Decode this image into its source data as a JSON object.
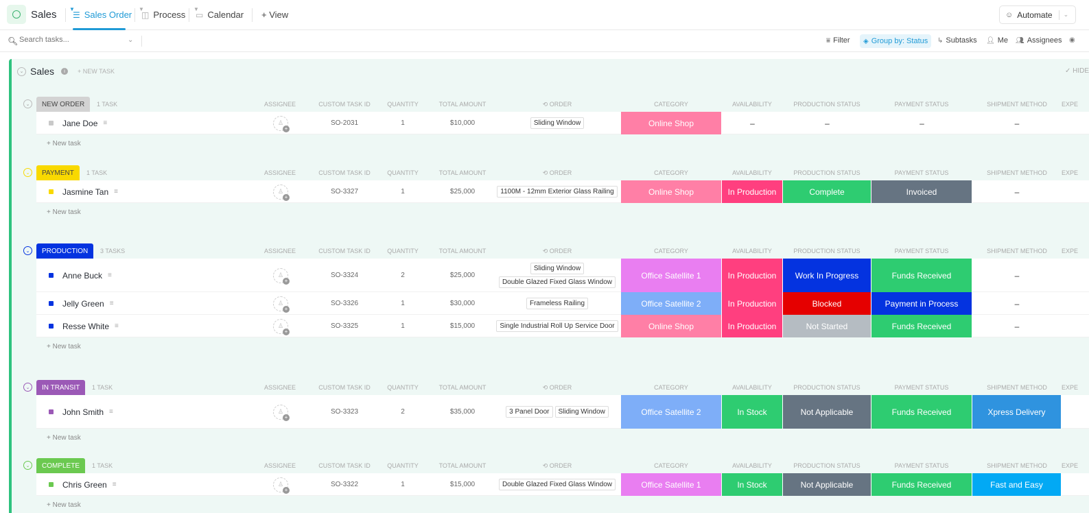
{
  "header": {
    "app_title": "Sales",
    "tabs": [
      {
        "label": "Sales Order",
        "icon": "list-icon",
        "active": true
      },
      {
        "label": "Process",
        "icon": "board-icon",
        "active": false
      },
      {
        "label": "Calendar",
        "icon": "calendar-icon",
        "active": false
      }
    ],
    "add_view_label": "+ View",
    "automate_label": "Automate"
  },
  "toolbar": {
    "search_placeholder": "Search tasks...",
    "filter_label": "Filter",
    "group_by_label": "Group by: Status",
    "subtasks_label": "Subtasks",
    "me_label": "Me",
    "assignees_label": "Assignees"
  },
  "list": {
    "title": "Sales",
    "new_task_label": "+ NEW TASK",
    "hide_label": "✓ HIDE"
  },
  "columns": [
    "ASSIGNEE",
    "CUSTOM TASK ID",
    "QUANTITY",
    "TOTAL AMOUNT",
    "ORDER",
    "CATEGORY",
    "AVAILABILITY",
    "PRODUCTION STATUS",
    "PAYMENT STATUS",
    "SHIPMENT METHOD",
    "EXPE"
  ],
  "new_task_row_label": "+ New task",
  "colors": {
    "accent": "#1f9ad6",
    "list_bar": "#2ec27e",
    "online_shop": "#ff7fa6",
    "office_satellite_1": "#e97ef1",
    "office_satellite_2": "#7eaef8",
    "in_production": "#ff3f7f",
    "in_stock": "#2ecc71",
    "complete": "#2ecc71",
    "invoiced": "#667482",
    "work_in_progress": "#0433e0",
    "blocked": "#e50000",
    "not_started": "#b5bcc2",
    "not_applicable": "#667482",
    "funds_received": "#2ecc71",
    "payment_in_process": "#0433e0",
    "xpress_delivery": "#2f93df",
    "fast_and_easy": "#02a9f4"
  },
  "groups": [
    {
      "status": "NEW ORDER",
      "count": "1 TASK",
      "badge_bg": "#d3d3d3",
      "badge_fg": "#444444",
      "tasks": [
        {
          "name": "Jane Doe",
          "id": "SO-2031",
          "quantity": "1",
          "amount": "$10,000",
          "order": [
            "Sliding Window"
          ],
          "category": "Online Shop",
          "category_color": "#ff7fa6",
          "availability": "–",
          "availability_color": null,
          "production": "–",
          "production_color": null,
          "payment": "–",
          "payment_color": null,
          "shipment": "–",
          "shipment_color": null
        }
      ]
    },
    {
      "status": "PAYMENT",
      "count": "1 TASK",
      "badge_bg": "#f9d900",
      "badge_fg": "#444444",
      "tasks": [
        {
          "name": "Jasmine Tan",
          "id": "SO-3327",
          "quantity": "1",
          "amount": "$25,000",
          "order": [
            "1100M - 12mm Exterior Glass Railing"
          ],
          "category": "Online Shop",
          "category_color": "#ff7fa6",
          "availability": "In Production",
          "availability_color": "#ff3f7f",
          "production": "Complete",
          "production_color": "#2ecc71",
          "payment": "Invoiced",
          "payment_color": "#667482",
          "shipment": "–",
          "shipment_color": null
        }
      ]
    },
    {
      "status": "PRODUCTION",
      "count": "3 TASKS",
      "badge_bg": "#0433e0",
      "badge_fg": "#ffffff",
      "tasks": [
        {
          "name": "Anne Buck",
          "id": "SO-3324",
          "quantity": "2",
          "amount": "$25,000",
          "order": [
            "Sliding Window",
            "Double Glazed Fixed Glass Window"
          ],
          "category": "Office Satellite 1",
          "category_color": "#e97ef1",
          "availability": "In Production",
          "availability_color": "#ff3f7f",
          "production": "Work In Progress",
          "production_color": "#0433e0",
          "payment": "Funds Received",
          "payment_color": "#2ecc71",
          "shipment": "–",
          "shipment_color": null
        },
        {
          "name": "Jelly Green",
          "id": "SO-3326",
          "quantity": "1",
          "amount": "$30,000",
          "order": [
            "Frameless Railing"
          ],
          "category": "Office Satellite 2",
          "category_color": "#7eaef8",
          "availability": "In Production",
          "availability_color": "#ff3f7f",
          "production": "Blocked",
          "production_color": "#e50000",
          "payment": "Payment in Process",
          "payment_color": "#0433e0",
          "shipment": "–",
          "shipment_color": null
        },
        {
          "name": "Resse White",
          "id": "SO-3325",
          "quantity": "1",
          "amount": "$15,000",
          "order": [
            "Single Industrial Roll Up Service Door"
          ],
          "category": "Online Shop",
          "category_color": "#ff7fa6",
          "availability": "In Production",
          "availability_color": "#ff3f7f",
          "production": "Not Started",
          "production_color": "#b5bcc2",
          "payment": "Funds Received",
          "payment_color": "#2ecc71",
          "shipment": "–",
          "shipment_color": null
        }
      ]
    },
    {
      "status": "IN TRANSIT",
      "count": "1 TASK",
      "badge_bg": "#9b59b6",
      "badge_fg": "#ffffff",
      "tasks": [
        {
          "name": "John Smith",
          "id": "SO-3323",
          "quantity": "2",
          "amount": "$35,000",
          "order": [
            "3 Panel Door",
            "Sliding Window"
          ],
          "category": "Office Satellite 2",
          "category_color": "#7eaef8",
          "availability": "In Stock",
          "availability_color": "#2ecc71",
          "production": "Not Applicable",
          "production_color": "#667482",
          "payment": "Funds Received",
          "payment_color": "#2ecc71",
          "shipment": "Xpress Delivery",
          "shipment_color": "#2f93df"
        }
      ]
    },
    {
      "status": "COMPLETE",
      "count": "1 TASK",
      "badge_bg": "#6bc950",
      "badge_fg": "#ffffff",
      "tasks": [
        {
          "name": "Chris Green",
          "id": "SO-3322",
          "quantity": "1",
          "amount": "$15,000",
          "order": [
            "Double Glazed Fixed Glass Window"
          ],
          "category": "Office Satellite 1",
          "category_color": "#e97ef1",
          "availability": "In Stock",
          "availability_color": "#2ecc71",
          "production": "Not Applicable",
          "production_color": "#667482",
          "payment": "Funds Received",
          "payment_color": "#2ecc71",
          "shipment": "Fast and Easy",
          "shipment_color": "#02a9f4"
        }
      ]
    }
  ]
}
